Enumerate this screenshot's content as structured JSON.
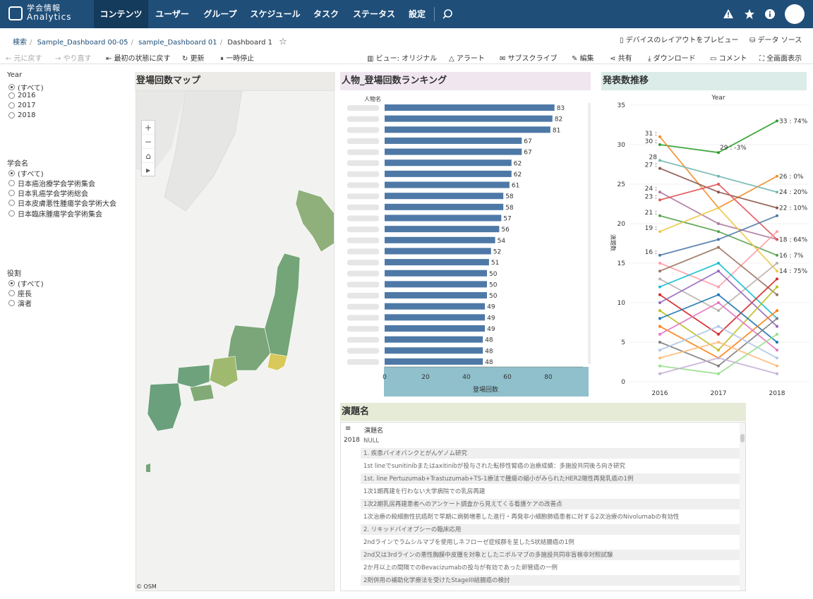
{
  "nav": {
    "logo_line1": "学会情報",
    "logo_line2": "Analytics",
    "items": [
      {
        "label": "コンテンツ",
        "active": true
      },
      {
        "label": "ユーザー"
      },
      {
        "label": "グループ"
      },
      {
        "label": "スケジュール"
      },
      {
        "label": "タスク"
      },
      {
        "label": "ステータス"
      },
      {
        "label": "設定"
      }
    ],
    "icons": [
      "search-icon",
      "alert-icon",
      "star-icon",
      "info-icon",
      "avatar"
    ]
  },
  "breadcrumb": {
    "items": [
      "検索",
      "Sample_Dashboard 00-05",
      "sample_Dashboard 01",
      "Dashboard 1"
    ]
  },
  "header_actions": {
    "preview": "デバイスのレイアウトをプレビュー",
    "data_source": "データ ソース"
  },
  "toolbar": {
    "undo": "元に戻す",
    "redo": "やり直す",
    "revert": "最初の状態に戻す",
    "refresh": "更新",
    "pause": "一時停止",
    "view": "ビュー: オリジナル",
    "alert": "アラート",
    "subscribe": "サブスクライブ",
    "edit": "編集",
    "share": "共有",
    "download": "ダウンロード",
    "comment": "コメント",
    "fullscreen": "全画面表示"
  },
  "filters": {
    "year": {
      "title": "Year",
      "options": [
        "(すべて)",
        "2016",
        "2017",
        "2018"
      ],
      "selected": "(すべて)"
    },
    "society": {
      "title": "学会名",
      "options": [
        "(すべて)",
        "日本癌治療学会学術集会",
        "日本乳癌学会学術総会",
        "日本皮膚悪性腫瘍学会学術大会",
        "日本臨床腫瘍学会学術集会"
      ],
      "selected": "(すべて)"
    },
    "role": {
      "title": "役割",
      "options": [
        "(すべて)",
        "座長",
        "演者"
      ],
      "selected": "(すべて)"
    }
  },
  "map_panel": {
    "title": "登場回数マップ",
    "attribution": "© OSM",
    "controls": [
      "+",
      "−",
      "⌂",
      "▸"
    ]
  },
  "ranking_panel": {
    "title": "人物_登場回数ランキング"
  },
  "trend_panel": {
    "title": "発表数推移"
  },
  "table_panel": {
    "title": "演題名",
    "column": "演題名",
    "year": "2018",
    "rows": [
      "NULL",
      "1. 疾患バイオバンクとがんゲノム研究",
      "1st lineでsunitinibまたはaxitinibが投与された転移性腎癌の治療成績：多施設共同後ろ向き研究",
      "1st. line Pertuzumab+Trastuzumab+TS-1療法で腫瘍の縮小がみられたHER2陽性再発乳癌の1例",
      "1次1期再建を行わない大学病院での乳房再建",
      "1次2期乳房再建患者へのアンケート調査から見えてくる看護ケアの改善点",
      "1次治療の殺細胞性抗癌剤で早期に病勢増悪した進行・再発非小細胞肺癌患者に対する2次治療のNivolumabの有効性",
      "2. リキッドバイオプシーの臨床応用",
      "2ndラインでラムシルマブを使用しネフローゼ症候群を呈したS状結腸癌の1例",
      "2nd又は3rdラインの悪性胸膜中皮腫を対象としたニボルマブの多施設共同非盲検非対照試験",
      "2か月以上の間隔でのBevacizumabの投与が有効であった卵管癌の一例",
      "2剤併用の補助化学療法を受けたStageIII結腸癌の検討"
    ]
  },
  "chart_data": [
    {
      "type": "bar",
      "orientation": "horizontal",
      "title": "人物_登場回数ランキング",
      "ylabel": "人物名",
      "xlabel": "登場回数",
      "xlim": [
        0,
        90
      ],
      "xticks": [
        0,
        20,
        40,
        60,
        80
      ],
      "color": "#4e79a7",
      "values": [
        83,
        82,
        81,
        67,
        67,
        62,
        62,
        61,
        58,
        58,
        57,
        56,
        54,
        52,
        51,
        50,
        50,
        50,
        49,
        49,
        49,
        48,
        48,
        48
      ]
    },
    {
      "type": "line",
      "title": "発表数推移",
      "xlabel": "Year",
      "ylabel": "演題数",
      "x": [
        "2016",
        "2017",
        "2018"
      ],
      "ylim": [
        0,
        35
      ],
      "yticks": [
        0,
        5,
        10,
        15,
        20,
        25,
        30,
        35
      ],
      "grid": true,
      "series": [
        {
          "values": [
            30,
            29,
            33
          ],
          "color": "#2ca02c",
          "label_end": "33 : 74%",
          "label_start": "30 :",
          "label_mid": "29 : -3%"
        },
        {
          "values": [
            31,
            22,
            26
          ],
          "color": "#f28e2b",
          "label_start": "31 :",
          "label_end": "26 : 0%"
        },
        {
          "values": [
            28,
            26,
            24
          ],
          "color": "#76b7b2",
          "label_start": "28",
          "label_end": "24 : 20%"
        },
        {
          "values": [
            27,
            24,
            22
          ],
          "color": "#8c564b",
          "label_start": "27 :",
          "label_end": "22 : 10%"
        },
        {
          "values": [
            24,
            20,
            18
          ],
          "color": "#b07aa1",
          "label_start": "24 :"
        },
        {
          "values": [
            23,
            25,
            18
          ],
          "color": "#e15759",
          "label_start": "23 :",
          "label_end": "18 : 64%"
        },
        {
          "values": [
            21,
            19,
            16
          ],
          "color": "#59a14f",
          "label_start": "21 :",
          "label_end": "16 : 7%"
        },
        {
          "values": [
            19,
            22,
            14
          ],
          "color": "#edc948",
          "label_start": "19 :",
          "label_end": "14 : 75%"
        },
        {
          "values": [
            16,
            18,
            21
          ],
          "color": "#4e79a7",
          "label_start": "16 :"
        },
        {
          "values": [
            15,
            12,
            19
          ],
          "color": "#ff9da7"
        },
        {
          "values": [
            14,
            17,
            11
          ],
          "color": "#9c755f"
        },
        {
          "values": [
            13,
            9,
            15
          ],
          "color": "#bab0ac"
        },
        {
          "values": [
            12,
            15,
            8
          ],
          "color": "#17becf"
        },
        {
          "values": [
            11,
            6,
            13
          ],
          "color": "#d62728"
        },
        {
          "values": [
            10,
            14,
            7
          ],
          "color": "#9467bd"
        },
        {
          "values": [
            9,
            4,
            12
          ],
          "color": "#bcbd22"
        },
        {
          "values": [
            8,
            11,
            5
          ],
          "color": "#1f77b4"
        },
        {
          "values": [
            7,
            3,
            9
          ],
          "color": "#ff7f0e"
        },
        {
          "values": [
            6,
            10,
            4
          ],
          "color": "#e377c2"
        },
        {
          "values": [
            5,
            2,
            8
          ],
          "color": "#7f7f7f"
        },
        {
          "values": [
            4,
            7,
            3
          ],
          "color": "#aec7e8"
        },
        {
          "values": [
            3,
            5,
            2
          ],
          "color": "#ffbb78"
        },
        {
          "values": [
            2,
            1,
            6
          ],
          "color": "#98df8a"
        },
        {
          "values": [
            1,
            3,
            1
          ],
          "color": "#c5b0d5"
        }
      ]
    }
  ]
}
